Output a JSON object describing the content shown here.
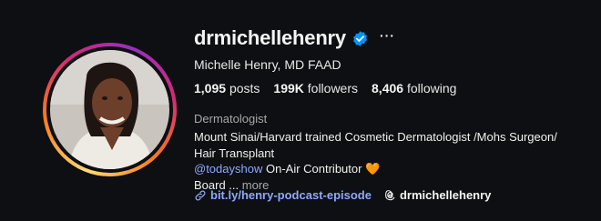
{
  "profile": {
    "username": "drmichellehenry",
    "full_name": "Michelle Henry, MD FAAD",
    "more_options": "···"
  },
  "stats": {
    "posts_count": "1,095",
    "posts_label": "posts",
    "followers_count": "199K",
    "followers_label": "followers",
    "following_count": "8,406",
    "following_label": "following"
  },
  "bio": {
    "category": "Dermatologist",
    "line1": "Mount Sinai/Harvard trained Cosmetic Dermatologist /Mohs Surgeon/ Hair Transplant",
    "mention": "@todayshow",
    "mention_suffix": " On-Air Contributor ",
    "heart": "🧡",
    "board": "Board ...",
    "more": "more"
  },
  "links": {
    "website": "bit.ly/henry-podcast-episode",
    "threads": "drmichellehenry"
  },
  "icons": [
    "verified-badge-icon",
    "link-icon",
    "threads-icon",
    "more-options-icon"
  ],
  "colors": {
    "background": "#0d0f12",
    "link": "#8fa8ff",
    "verified": "#0095f6"
  }
}
